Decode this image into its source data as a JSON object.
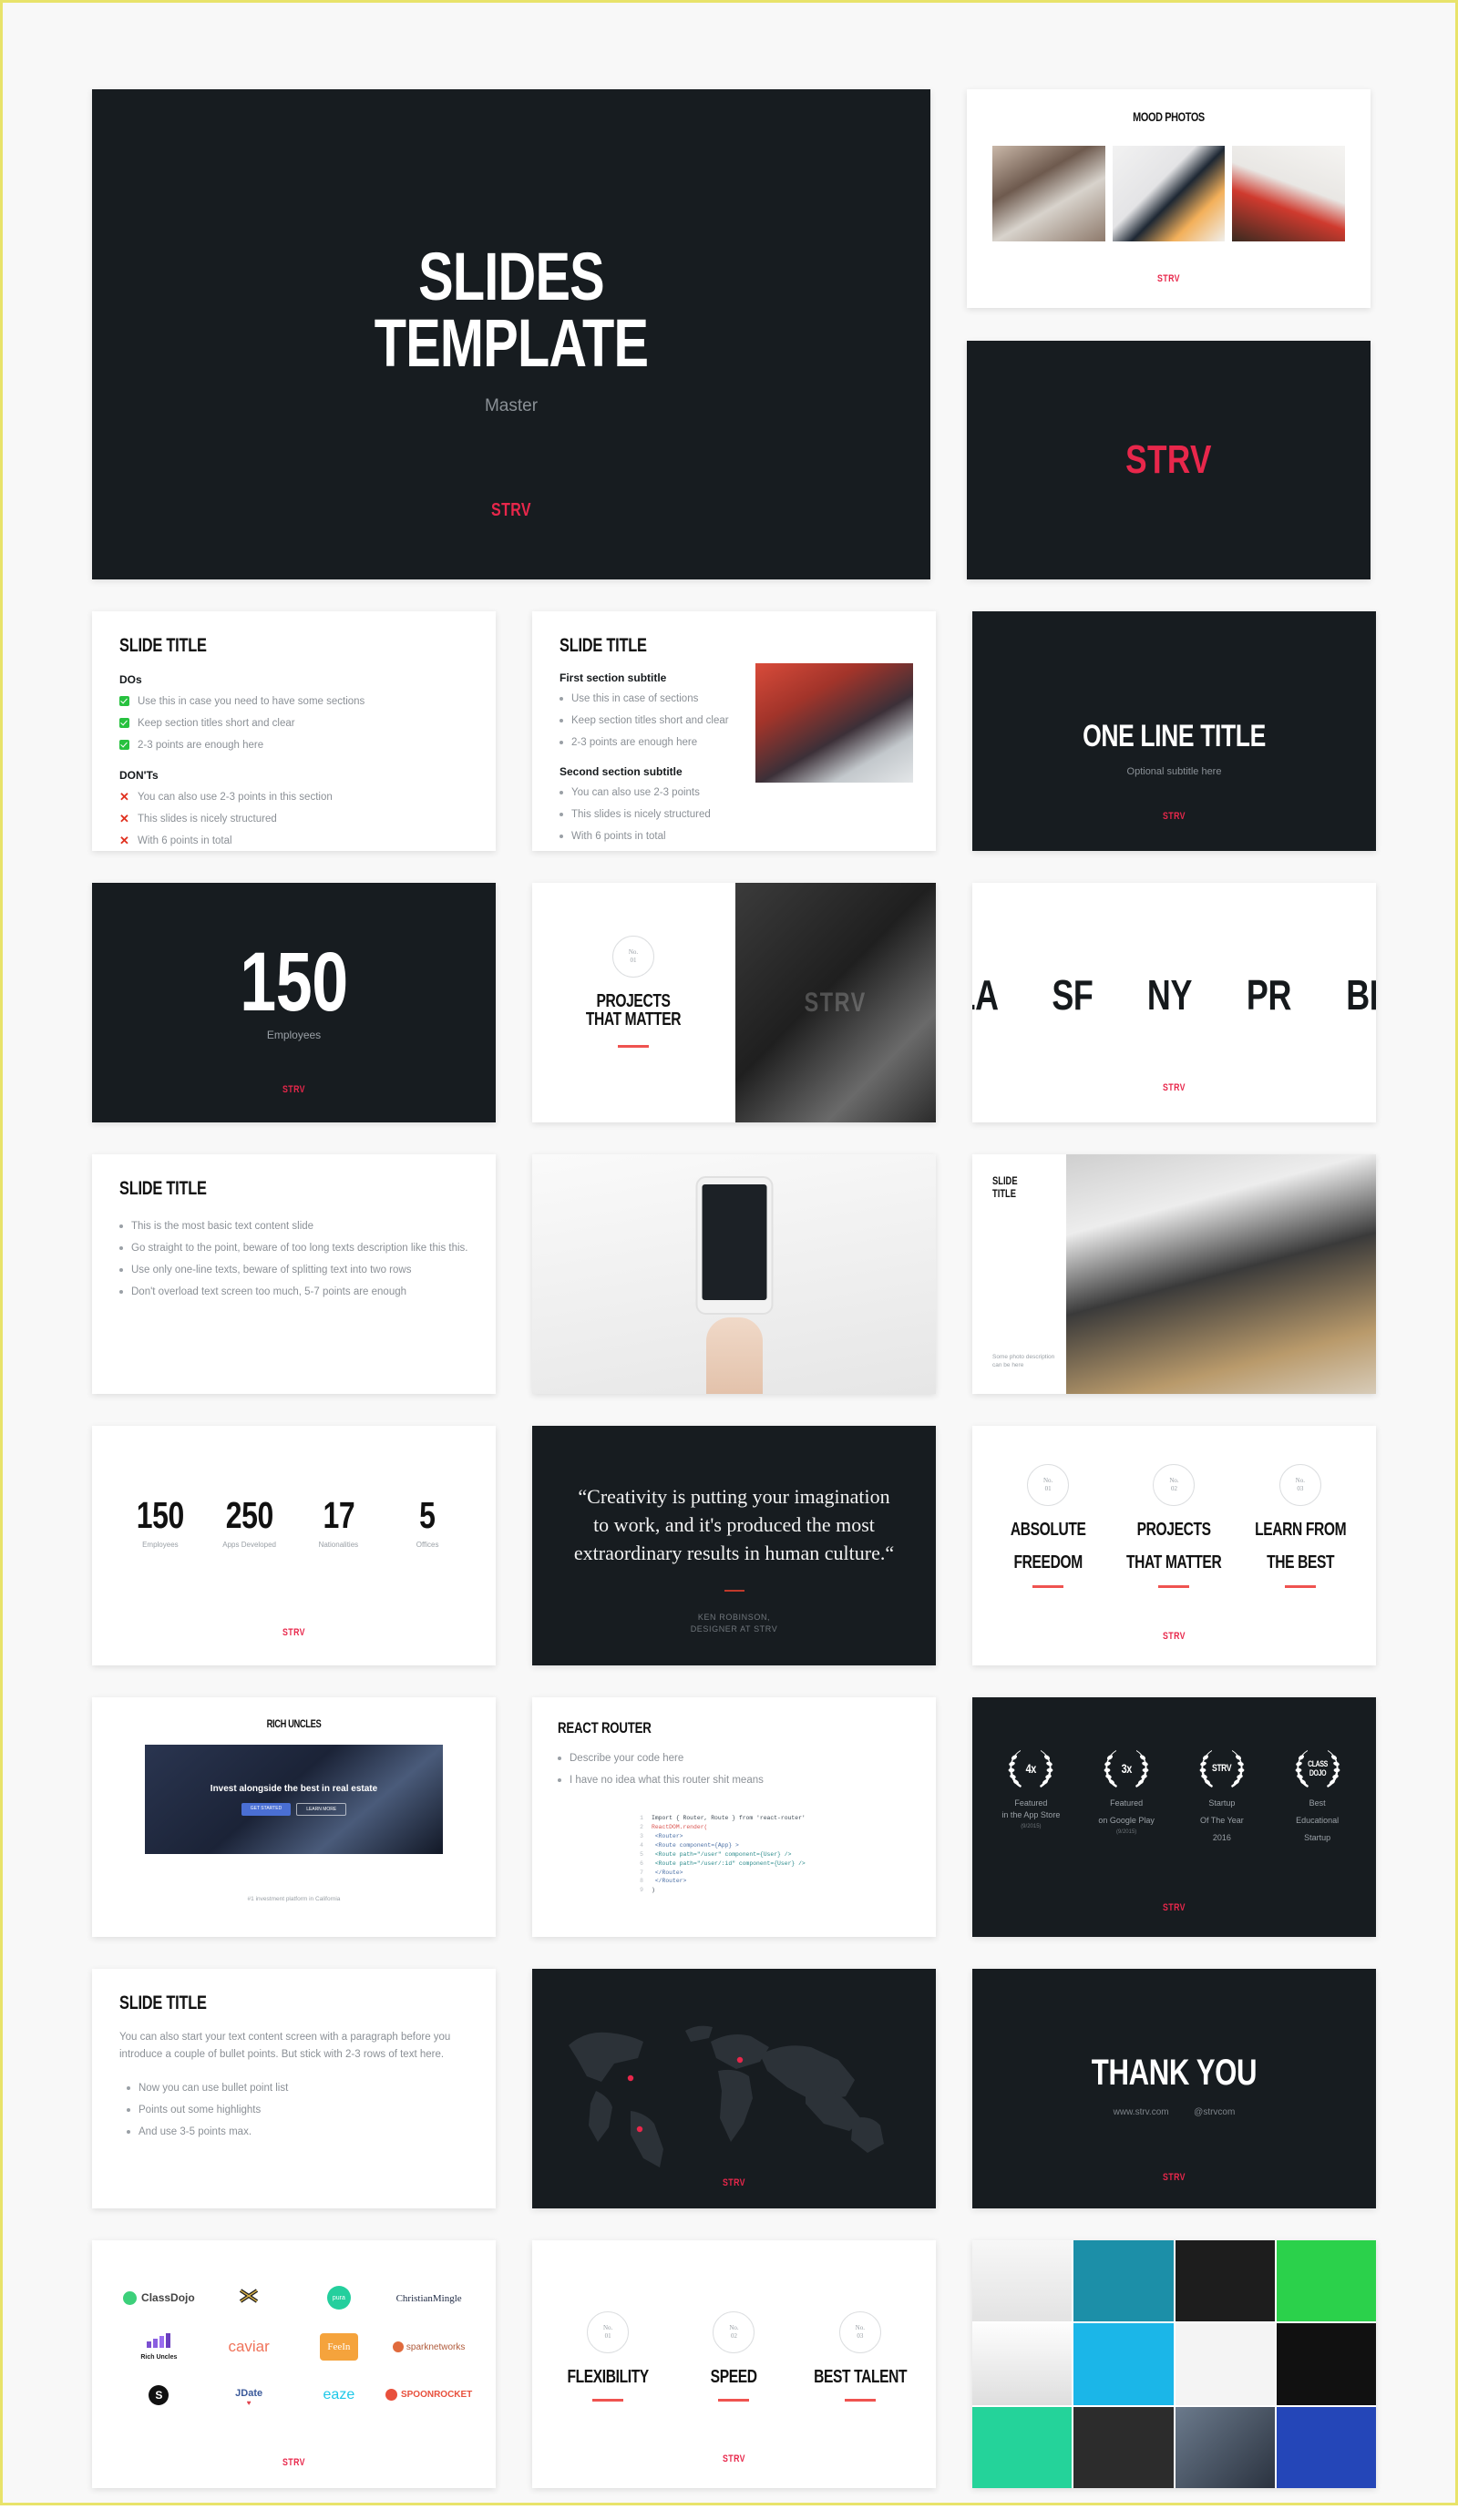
{
  "brand": {
    "name": "STRV",
    "accent": "#e8274b",
    "dark": "#171c20"
  },
  "hero": {
    "title_line1": "SLIDES",
    "title_line2": "TEMPLATE",
    "subtitle": "Master",
    "logo": "STRV"
  },
  "mood": {
    "title": "MOOD PHOTOS",
    "logo": "STRV",
    "photos": [
      "phone-on-desk-photo",
      "notebook-and-tablet-photo",
      "headphones-and-card-photo"
    ]
  },
  "brand_slide": {
    "logo": "STRV"
  },
  "dos_donts": {
    "title": "SLIDE TITLE",
    "dos_heading": "DOs",
    "dos": [
      "Use this in case you need to have some sections",
      "Keep section titles short and clear",
      "2-3 points are enough here"
    ],
    "donts_heading": "DON'Ts",
    "donts": [
      "You can also use 2-3 points in this section",
      "This slides is nicely structured",
      "With 6 points in total"
    ]
  },
  "sections": {
    "title": "SLIDE TITLE",
    "first_heading": "First section subtitle",
    "first_items": [
      "Use this in case of sections",
      "Keep section titles short and clear",
      "2-3 points are enough here"
    ],
    "second_heading": "Second section subtitle",
    "second_items": [
      "You can also use 2-3 points",
      "This slides is nicely structured",
      "With 6 points in total"
    ],
    "photo": "man-with-laptop-photo"
  },
  "one_line": {
    "title": "ONE LINE TITLE",
    "subtitle": "Optional subtitle here",
    "logo": "STRV"
  },
  "stat_big": {
    "value": "150",
    "label": "Employees",
    "logo": "STRV"
  },
  "projects": {
    "no_label_top": "No.",
    "no_label_bottom": "01",
    "line1": "PROJECTS",
    "line2": "THAT MATTER",
    "photo": "monitor-strv-photo"
  },
  "cities": {
    "items": [
      "LA",
      "SF",
      "NY",
      "PR",
      "BR"
    ],
    "logo": "STRV"
  },
  "basic_text": {
    "title": "SLIDE TITLE",
    "bullets": [
      "This is the most basic text content slide",
      "Go straight to the point, beware of too long texts description like this this.",
      "Use only one-line texts, beware of splitting text into two rows",
      "Don't overload text screen too much, 5-7 points are enough"
    ]
  },
  "phone_slide": {
    "photo": "hand-holding-iphone-photo"
  },
  "photo_caption_slide": {
    "title": "SLIDE TITLE",
    "caption": "Some photo description can be here",
    "photo": "desk-with-tablet-photo"
  },
  "stats_four": {
    "items": [
      {
        "value": "150",
        "label": "Employees"
      },
      {
        "value": "250",
        "label": "Apps Developed"
      },
      {
        "value": "17",
        "label": "Nationalities"
      },
      {
        "value": "5",
        "label": "Offices"
      }
    ],
    "logo": "STRV"
  },
  "quote": {
    "text": "“Creativity is putting your imagination to work, and it's produced the most extraordinary results in human culture.“",
    "author_line1": "KEN ROBINSON,",
    "author_line2": "DESIGNER AT STRV"
  },
  "features": {
    "items": [
      {
        "no_top": "No.",
        "no_bottom": "01",
        "line1": "ABSOLUTE",
        "line2": "FREEDOM"
      },
      {
        "no_top": "No.",
        "no_bottom": "02",
        "line1": "PROJECTS",
        "line2": "THAT MATTER"
      },
      {
        "no_top": "No.",
        "no_bottom": "03",
        "line1": "LEARN FROM",
        "line2": "THE BEST"
      }
    ],
    "logo": "STRV"
  },
  "rich_uncles": {
    "title": "RICH UNCLES",
    "hero_text": "Invest alongside the best in real estate",
    "caption": "#1 investment platform in California",
    "photo": "rich-uncles-website-photo"
  },
  "react_router": {
    "title": "REACT ROUTER",
    "bullets": [
      "Describe your code here",
      "I have no idea what this router shit means"
    ],
    "code": [
      "Import { Router, Route } from 'react-router'",
      "ReactDOM.render(",
      "  <Router>",
      "    <Route component={App} >",
      "      <Route path=\"/user\" component={User} />",
      "      <Route path=\"/user/:id\" component={User} />",
      "    </Route>",
      "  </Router>",
      ")"
    ],
    "line_numbers": [
      "1",
      "2",
      "3",
      "4",
      "5",
      "6",
      "7",
      "8",
      "9"
    ]
  },
  "awards": {
    "items": [
      {
        "badge": "4x",
        "caption_line1": "Featured",
        "caption_line2": "in the App Store",
        "note": "(9/2015)"
      },
      {
        "badge": "3x",
        "caption_line1": "Featured",
        "caption_line2": "on Google Play",
        "note": "(9/2015)"
      },
      {
        "badge": "STRV",
        "caption_line1": "Startup",
        "caption_line2": "Of The Year",
        "caption_line3": "2016",
        "note": ""
      },
      {
        "badge": "CLASS DOJO",
        "caption_line1": "Best",
        "caption_line2": "Educational",
        "caption_line3": "Startup",
        "note": ""
      }
    ],
    "logo": "STRV"
  },
  "paragraph_slide": {
    "title": "SLIDE TITLE",
    "paragraph": "You can also start your text content screen with a paragraph before you introduce a couple of bullet points. But stick with 2-3 rows of text here.",
    "bullets": [
      "Now you can use bullet point list",
      "Points out some highlights",
      "And use 3-5 points max."
    ]
  },
  "map_slide": {
    "logo": "STRV",
    "markers": 3
  },
  "thank_you": {
    "title": "THANK YOU",
    "website": "www.strv.com",
    "handle": "@strvcom",
    "logo": "STRV"
  },
  "clients": {
    "logos": [
      "ClassDojo",
      "cross-logo",
      "pura",
      "ChristianMingle",
      "Rich Uncles",
      "caviar",
      "FeeIn",
      "sparknetworks",
      "s-circle-logo",
      "JDate",
      "eaze",
      "SPOONROCKET"
    ],
    "logo": "STRV"
  },
  "values": {
    "items": [
      {
        "no_top": "No.",
        "no_bottom": "01",
        "label": "FLEXIBILITY"
      },
      {
        "no_top": "No.",
        "no_bottom": "02",
        "label": "SPEED"
      },
      {
        "no_top": "No.",
        "no_bottom": "03",
        "label": "BEST TALENT"
      }
    ],
    "logo": "STRV"
  },
  "app_grid": {
    "tiles": 12
  }
}
